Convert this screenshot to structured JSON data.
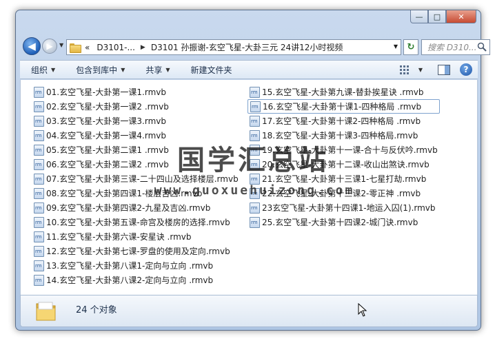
{
  "window": {
    "caption_min": "—",
    "caption_max": "□",
    "caption_close": "✕"
  },
  "nav": {
    "back_glyph": "◀",
    "forward_glyph": "▶",
    "breadcrumb_prefix": "«",
    "breadcrumb_parent": "D3101-...",
    "breadcrumb_current": "D3101 孙振谢-玄空飞星-大卦三元 24讲12小时视频",
    "refresh_glyph": "↻",
    "search_placeholder": "搜索 D310..."
  },
  "toolbar": {
    "organize": "组织",
    "include_in_library": "包含到库中",
    "share": "共享",
    "new_folder": "新建文件夹"
  },
  "files_col1": [
    "01.玄空飞星-大卦第一课1.rmvb",
    "02.玄空飞星-大卦第一课2 .rmvb",
    "03.玄空飞星-大卦第一课3.rmvb",
    "04.玄空飞星-大卦第一课4.rmvb",
    "05.玄空飞星-大卦第二课1 .rmvb",
    "06.玄空飞星-大卦第二课2 .rmvb",
    "07.玄空飞星-大卦第三课-二十四山及选择楼层.rmvb",
    "08.玄空飞星-大卦第四课1-楼层吉凶.rmvb",
    "09.玄空飞星-大卦第四课2-九星及吉凶.rmvb",
    "10.玄空飞星-大卦第五课-命宫及楼房的选择.rmvb",
    "11.玄空飞星-大卦第六课-安星诀 .rmvb",
    "12.玄空飞星-大卦第七课-罗盘的使用及定向.rmvb",
    "13.玄空飞星-大卦第八课1-定向与立向 .rmvb",
    "14.玄空飞星-大卦第八课2-定向与立向 .rmvb"
  ],
  "files_col2": [
    "15.玄空飞星-大卦第九课-替卦挨星诀 .rmvb",
    "16.玄空飞星-大卦第十课1-四种格局 .rmvb",
    "17.玄空飞星-大卦第十课2-四种格局 .rmvb",
    "18.玄空飞星-大卦第十课3-四种格局.rmvb",
    "19.玄空飞星-大卦第十一课-合十与反伏吟.rmvb",
    "20.玄空飞星-大卦第十二课-收山出煞诀.rmvb",
    "21.玄空飞星-大卦第十三课1-七星打劫.rmvb",
    "22.玄空飞星-大卦第十三课2-零正神 .rmvb",
    "23玄空飞星-大卦第十四课1-地运入囚(1).rmvb",
    "25.玄空飞星-大卦第十四课2-城门诀.rmvb"
  ],
  "watermark": {
    "title": "国学汇总站",
    "url": "www.guoxuehuizong.com"
  },
  "status": {
    "count_text": "24 个对象"
  }
}
